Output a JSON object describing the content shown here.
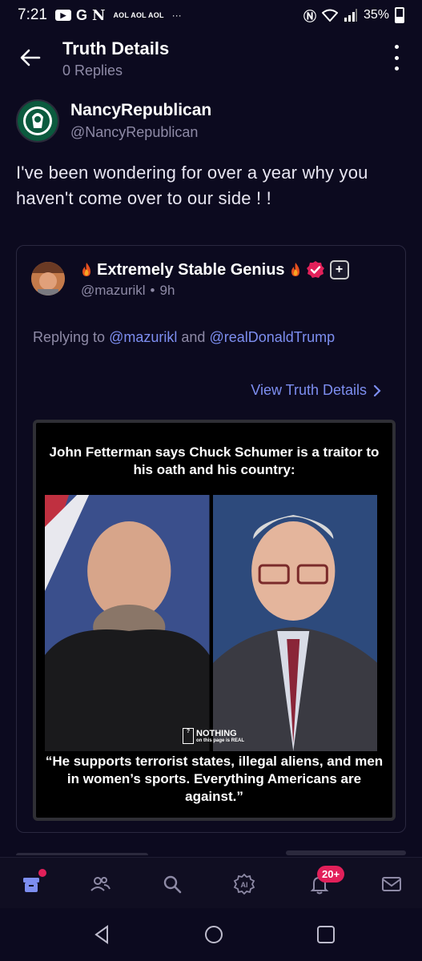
{
  "status_bar": {
    "time": "7:21",
    "apps": [
      "G",
      "N"
    ],
    "aol": "AOL AOL AOL",
    "more": "···",
    "battery": "35%"
  },
  "header": {
    "title": "Truth Details",
    "replies": "0 Replies"
  },
  "post": {
    "author_name": "NancyRepublican",
    "author_handle": "@NancyRepublican",
    "text": "I've been wondering for over a year why you haven't come over to our side ! !"
  },
  "quoted": {
    "author_name": "Extremely Stable Genius",
    "author_handle": "@mazurikl",
    "separator": "•",
    "time": "9h",
    "replying_prefix": "Replying to",
    "replying_user1": "@mazurikl",
    "replying_and": "and",
    "replying_user2": "@realDonaldTrump",
    "view_link": "View Truth Details",
    "media": {
      "headline": "John Fetterman says Chuck Schumer is a traitor to his oath and his country:",
      "watermark_line1": "NOTHING",
      "watermark_line2": "on this page is REAL",
      "quote": "“He supports terrorist states, illegal aliens, and men in women’s sports. Everything Americans are against.”"
    }
  },
  "bottom_nav": {
    "notification_badge": "20+"
  },
  "colors": {
    "background": "#0c0a1f",
    "link": "#7d8ef0",
    "muted": "#8e8aa6",
    "badge": "#e2205a"
  },
  "icons": [
    "back-arrow-icon",
    "more-vertical-icon",
    "flame-icon",
    "verified-icon",
    "plus-icon",
    "chevron-right-icon",
    "home-icon",
    "people-icon",
    "search-icon",
    "ai-icon",
    "bell-icon",
    "mail-icon"
  ]
}
